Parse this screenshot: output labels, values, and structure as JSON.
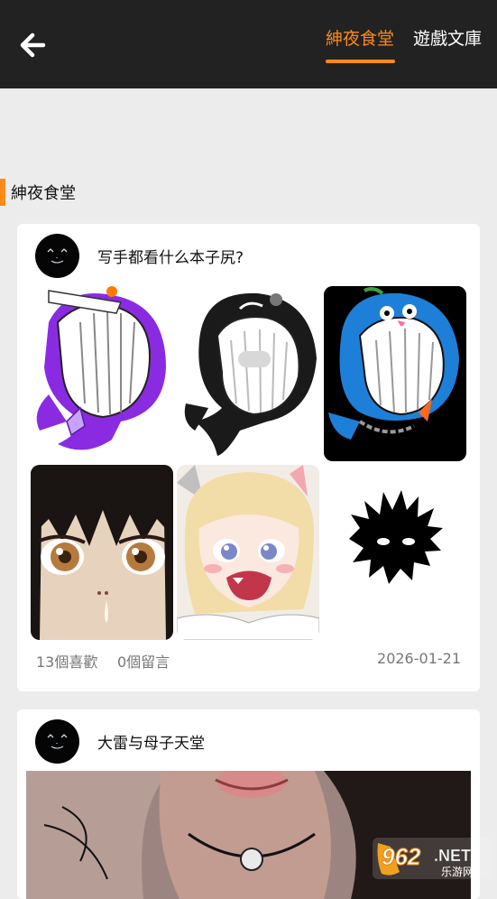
{
  "header": {
    "back_icon": "arrow-left-icon",
    "tabs": [
      {
        "label": "紳夜食堂",
        "active": true
      },
      {
        "label": "遊戲文庫",
        "active": false
      }
    ],
    "accent_color": "#ff8a1a"
  },
  "section": {
    "title": "紳夜食堂"
  },
  "posts": [
    {
      "title": "写手都看什么本子尻?",
      "likes": "13個喜歡",
      "comments": "0個留言",
      "date": "2026-01-21",
      "images": [
        "purple-whale-sticker",
        "black-orca-sticker",
        "blue-whale-sticker",
        "anime-girl-eyes",
        "anime-blonde-girl",
        "black-fuzzy-silhouette"
      ]
    },
    {
      "title": "大雷与母子天堂",
      "images": [
        "photo"
      ]
    }
  ],
  "watermark": {
    "number": "962",
    "suffix": ".NET",
    "subtitle": "乐游网"
  }
}
